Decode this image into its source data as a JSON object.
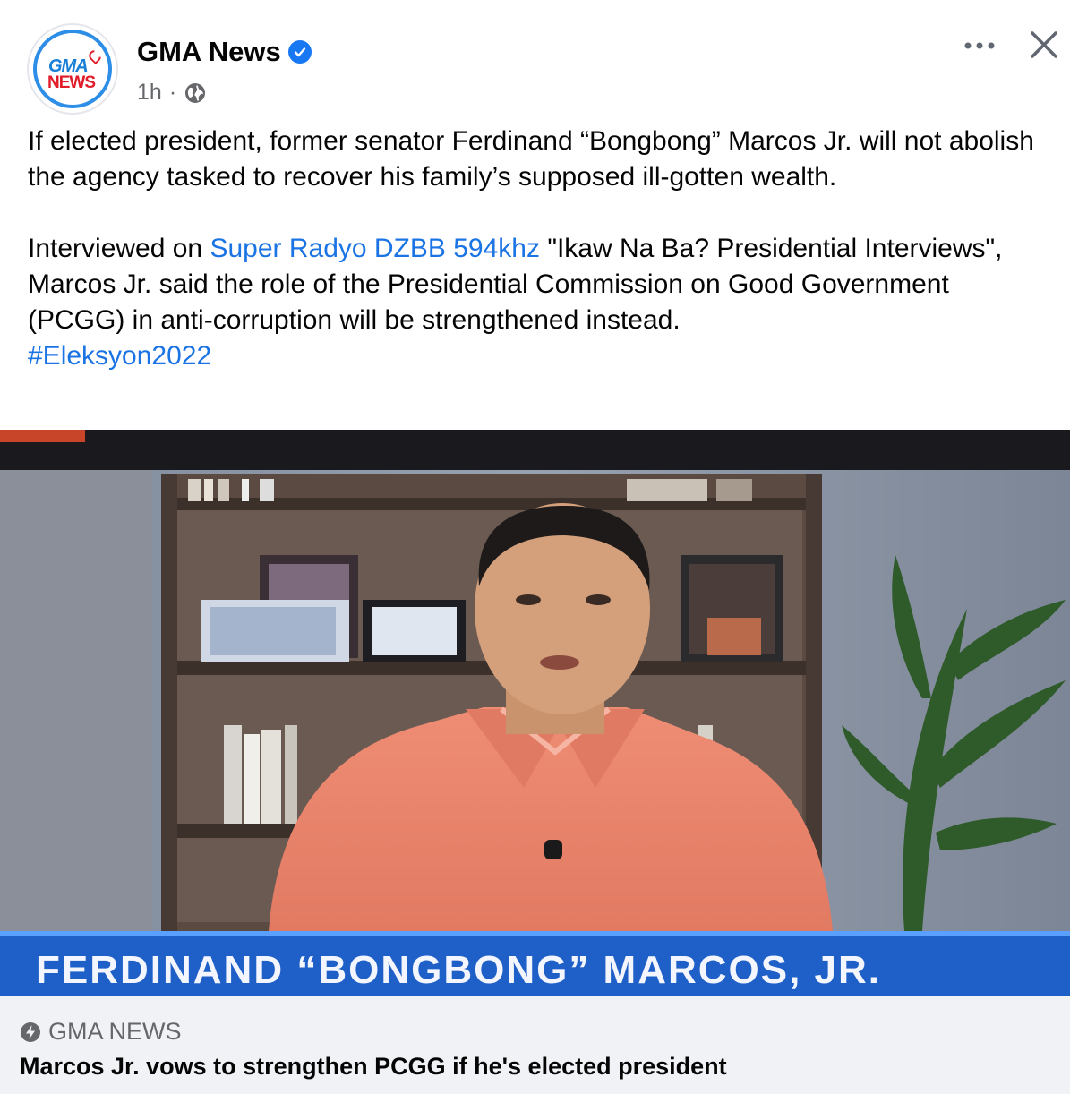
{
  "post": {
    "page_name": "GMA News",
    "verified": true,
    "time": "1h",
    "privacy_icon": "globe-icon",
    "logo_text_top": "GMA",
    "logo_text_bottom": "NEWS",
    "paragraph1": "If elected president, former senator Ferdinand “Bongbong” Marcos Jr. will not abolish the agency tasked to recover his family’s supposed ill-gotten wealth.",
    "paragraph2_prefix": "Interviewed on ",
    "paragraph2_link": "Super Radyo DZBB 594khz",
    "paragraph2_rest": " \"Ikaw Na Ba? Presidential Interviews\", Marcos Jr. said the role of the Presidential Commission on Good Government (PCGG) in anti-corruption will be strengthened instead.",
    "hashtag": "#Eleksyon2022"
  },
  "media": {
    "lower_third": "FERDINAND “BONGBONG” MARCOS, JR."
  },
  "link_card": {
    "source": "GMA NEWS",
    "headline": "Marcos Jr. vows to strengthen PCGG if he's elected president"
  },
  "colors": {
    "link": "#1b74e4",
    "verified": "#1877f2",
    "banner_blue": "#1f5fc8",
    "shirt": "#e8836a"
  }
}
